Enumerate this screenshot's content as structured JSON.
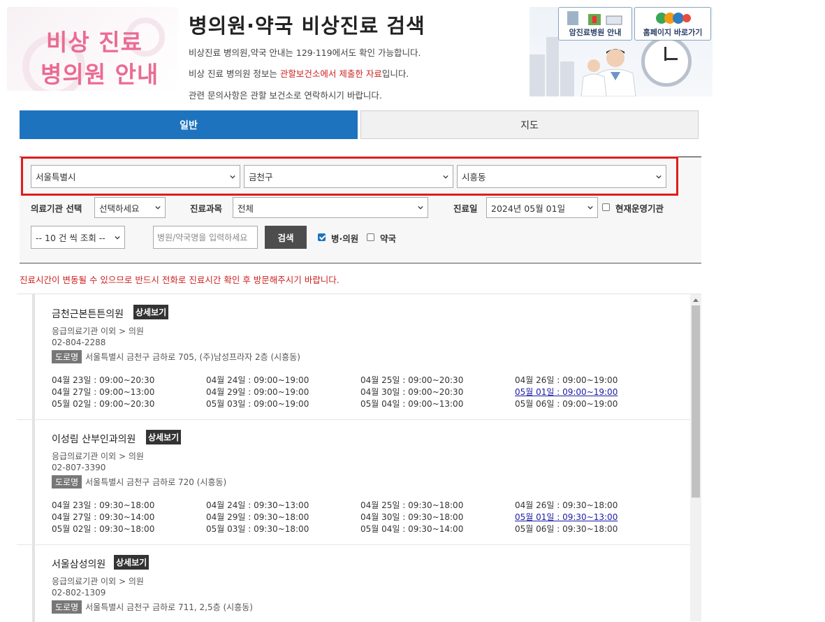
{
  "header": {
    "logo_line1": "비상 진료",
    "logo_line2": "병의원 안내",
    "title": "병의원·약국 비상진료 검색",
    "desc1": "비상진료 병의원,약국 안내는 129·119에서도 확인 가능합니다.",
    "desc2_a": "비상 진료 병의원 정보는 ",
    "desc2_red": "관할보건소에서 제출한 자료",
    "desc2_b": "입니다.",
    "desc3": "관련 문의사항은 관할 보건소로 연락하시기 바랍니다.",
    "btn_cancer": "암진료병원 안내",
    "btn_home": "홈페이지 바로가기"
  },
  "tabs": {
    "general": "일반",
    "map": "지도"
  },
  "filters": {
    "sido": "서울특별시",
    "sigungu": "금천구",
    "dong": "시흥동",
    "inst_label": "의료기관 선택",
    "inst_value": "선택하세요",
    "dept_label": "진료과목",
    "dept_value": "전체",
    "date_label": "진료일",
    "date_value": "2024년 05월 01일",
    "open_now": "현재운영기관",
    "page_size": "-- 10 건 씩 조회 --",
    "search_placeholder": "병원/약국명을 입력하세요",
    "search_btn": "검색",
    "hospital": "병·의원",
    "pharmacy": "약국"
  },
  "notice": "진료시간이 변동될 수 있으므로 반드시 전화로 진료시간 확인 후 방문해주시기 바랍니다.",
  "road_label": "도로명",
  "detail_label": "상세보기",
  "entries": [
    {
      "name": "금천근본튼튼의원",
      "type": "응급의료기관 이외 > 의원",
      "phone": "02-804-2288",
      "address": "서울특별시 금천구 금하로 705, (주)남성프라자 2층 (시흥동)",
      "schedule": [
        [
          "04월 23일 : 09:00~20:30",
          "04월 24일 : 09:00~19:00",
          "04월 25일 : 09:00~20:30",
          "04월 26일 : 09:00~19:00"
        ],
        [
          "04월 27일 : 09:00~13:00",
          "04월 29일 : 09:00~19:00",
          "04월 30일 : 09:00~20:30",
          "05월 01일 : 09:00~19:00"
        ],
        [
          "05월 02일 : 09:00~20:30",
          "05월 03일 : 09:00~19:00",
          "05월 04일 : 09:00~13:00",
          "05월 06일 : 09:00~19:00"
        ]
      ]
    },
    {
      "name": "이성림 산부인과의원",
      "type": "응급의료기관 이외 > 의원",
      "phone": "02-807-3390",
      "address": "서울특별시 금천구 금하로 720 (시흥동)",
      "schedule": [
        [
          "04월 23일 : 09:30~18:00",
          "04월 24일 : 09:30~13:00",
          "04월 25일 : 09:30~18:00",
          "04월 26일 : 09:30~18:00"
        ],
        [
          "04월 27일 : 09:30~14:00",
          "04월 29일 : 09:30~18:00",
          "04월 30일 : 09:30~18:00",
          "05월 01일 : 09:30~13:00"
        ],
        [
          "05월 02일 : 09:30~18:00",
          "05월 03일 : 09:30~18:00",
          "05월 04일 : 09:30~14:00",
          "05월 06일 : 09:30~18:00"
        ]
      ]
    },
    {
      "name": "서울삼성의원",
      "type": "응급의료기관 이외 > 의원",
      "phone": "02-802-1309",
      "address": "서울특별시 금천구 금하로 711, 2,5층 (시흥동)",
      "schedule": []
    }
  ],
  "colors": {
    "tab_active": "#1e73be",
    "highlight": "#e21b1b",
    "notice": "#cc2222",
    "logo": "#ea6b93"
  }
}
